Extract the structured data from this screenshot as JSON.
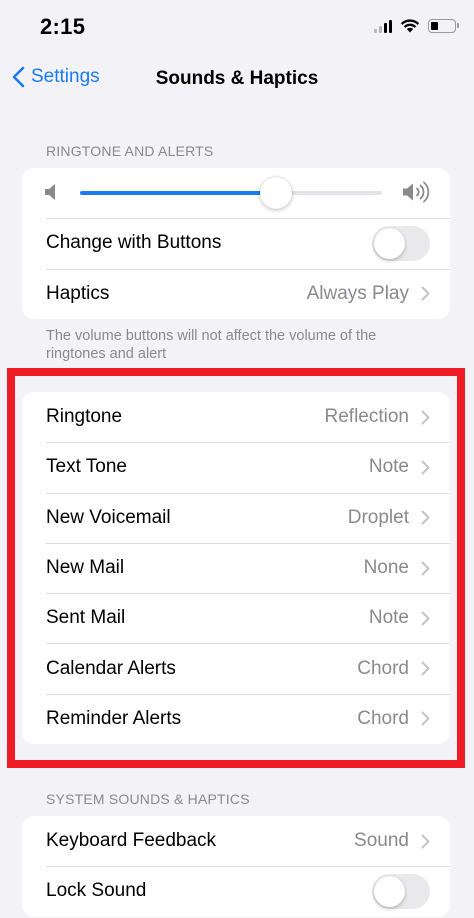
{
  "status_bar": {
    "time": "2:15"
  },
  "nav": {
    "back_label": "Settings",
    "title": "Sounds & Haptics"
  },
  "ringtone_section": {
    "header": "RINGTONE AND ALERTS",
    "volume_level": 0.65,
    "change_with_buttons_label": "Change with Buttons",
    "change_with_buttons_on": false,
    "haptics_label": "Haptics",
    "haptics_value": "Always Play",
    "footnote": "The volume buttons will not affect the volume of the ringtones and alert"
  },
  "tones": [
    {
      "label": "Ringtone",
      "value": "Reflection"
    },
    {
      "label": "Text Tone",
      "value": "Note"
    },
    {
      "label": "New Voicemail",
      "value": "Droplet"
    },
    {
      "label": "New Mail",
      "value": "None"
    },
    {
      "label": "Sent Mail",
      "value": "Note"
    },
    {
      "label": "Calendar Alerts",
      "value": "Chord"
    },
    {
      "label": "Reminder Alerts",
      "value": "Chord"
    }
  ],
  "system_section": {
    "header": "SYSTEM SOUNDS & HAPTICS",
    "keyboard_label": "Keyboard Feedback",
    "keyboard_value": "Sound",
    "lock_sound_label": "Lock Sound",
    "lock_sound_on": false
  },
  "colors": {
    "accent": "#1a7cf5",
    "highlight": "#ef1c25",
    "background": "#f2f2f7"
  }
}
